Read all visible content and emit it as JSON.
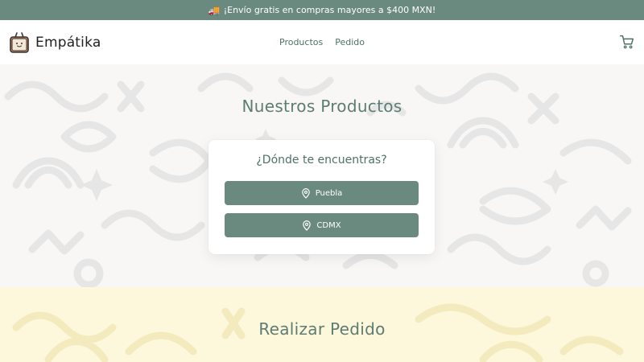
{
  "promo": {
    "icon": "truck-icon",
    "text": "¡Envío gratis en compras mayores a $400 MXN!"
  },
  "brand": {
    "name": "Empátika",
    "logo_icon": "tote-bag-smile-icon"
  },
  "nav": {
    "links": [
      "Productos",
      "Pedido"
    ],
    "cart_icon": "cart-icon"
  },
  "products": {
    "title": "Nuestros Productos",
    "prompt": "¿Dónde te encuentras?",
    "locations": [
      {
        "label": "Puebla",
        "icon": "map-pin-icon"
      },
      {
        "label": "CDMX",
        "icon": "map-pin-icon"
      }
    ]
  },
  "order": {
    "title": "Realizar Pedido"
  },
  "colors": {
    "primary": "#6a8a80",
    "heading": "#5d7d72",
    "section_bg": "#f8f7f6",
    "order_bg": "#fdf7dc"
  }
}
